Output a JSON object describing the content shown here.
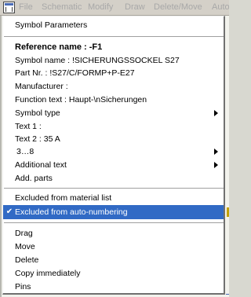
{
  "menubar": {
    "items": [
      "File",
      "Schematic",
      "Modify",
      "Draw",
      "Delete/Move",
      "Auto"
    ]
  },
  "context_menu": {
    "title": "Symbol Parameters",
    "reference": "Reference name   :   -F1",
    "symbol_name": "Symbol name           :   !SICHERUNGSSOCKEL S27",
    "part_nr": "Part Nr.                   :   !S27/C/FORMP+P-E27",
    "manufacturer": "Manufacturer   :",
    "function_text": "Function text          :   Haupt-\\nSicherungen",
    "symbol_type": "Symbol type",
    "text1": "Text 1   :",
    "text2": "Text 2   :   35 A",
    "text3_8": "3…8",
    "additional_text": "Additional text",
    "add_parts": "Add. parts",
    "excluded_material": "Excluded from material list",
    "excluded_numbering": "Excluded from auto-numbering",
    "drag": "Drag",
    "move": "Move",
    "delete": "Delete",
    "copy_immediately": "Copy immediately",
    "pins": "Pins",
    "check_mark": "✔"
  },
  "colors": {
    "highlight": "#316ac5",
    "menu_bg": "#ffffff"
  }
}
